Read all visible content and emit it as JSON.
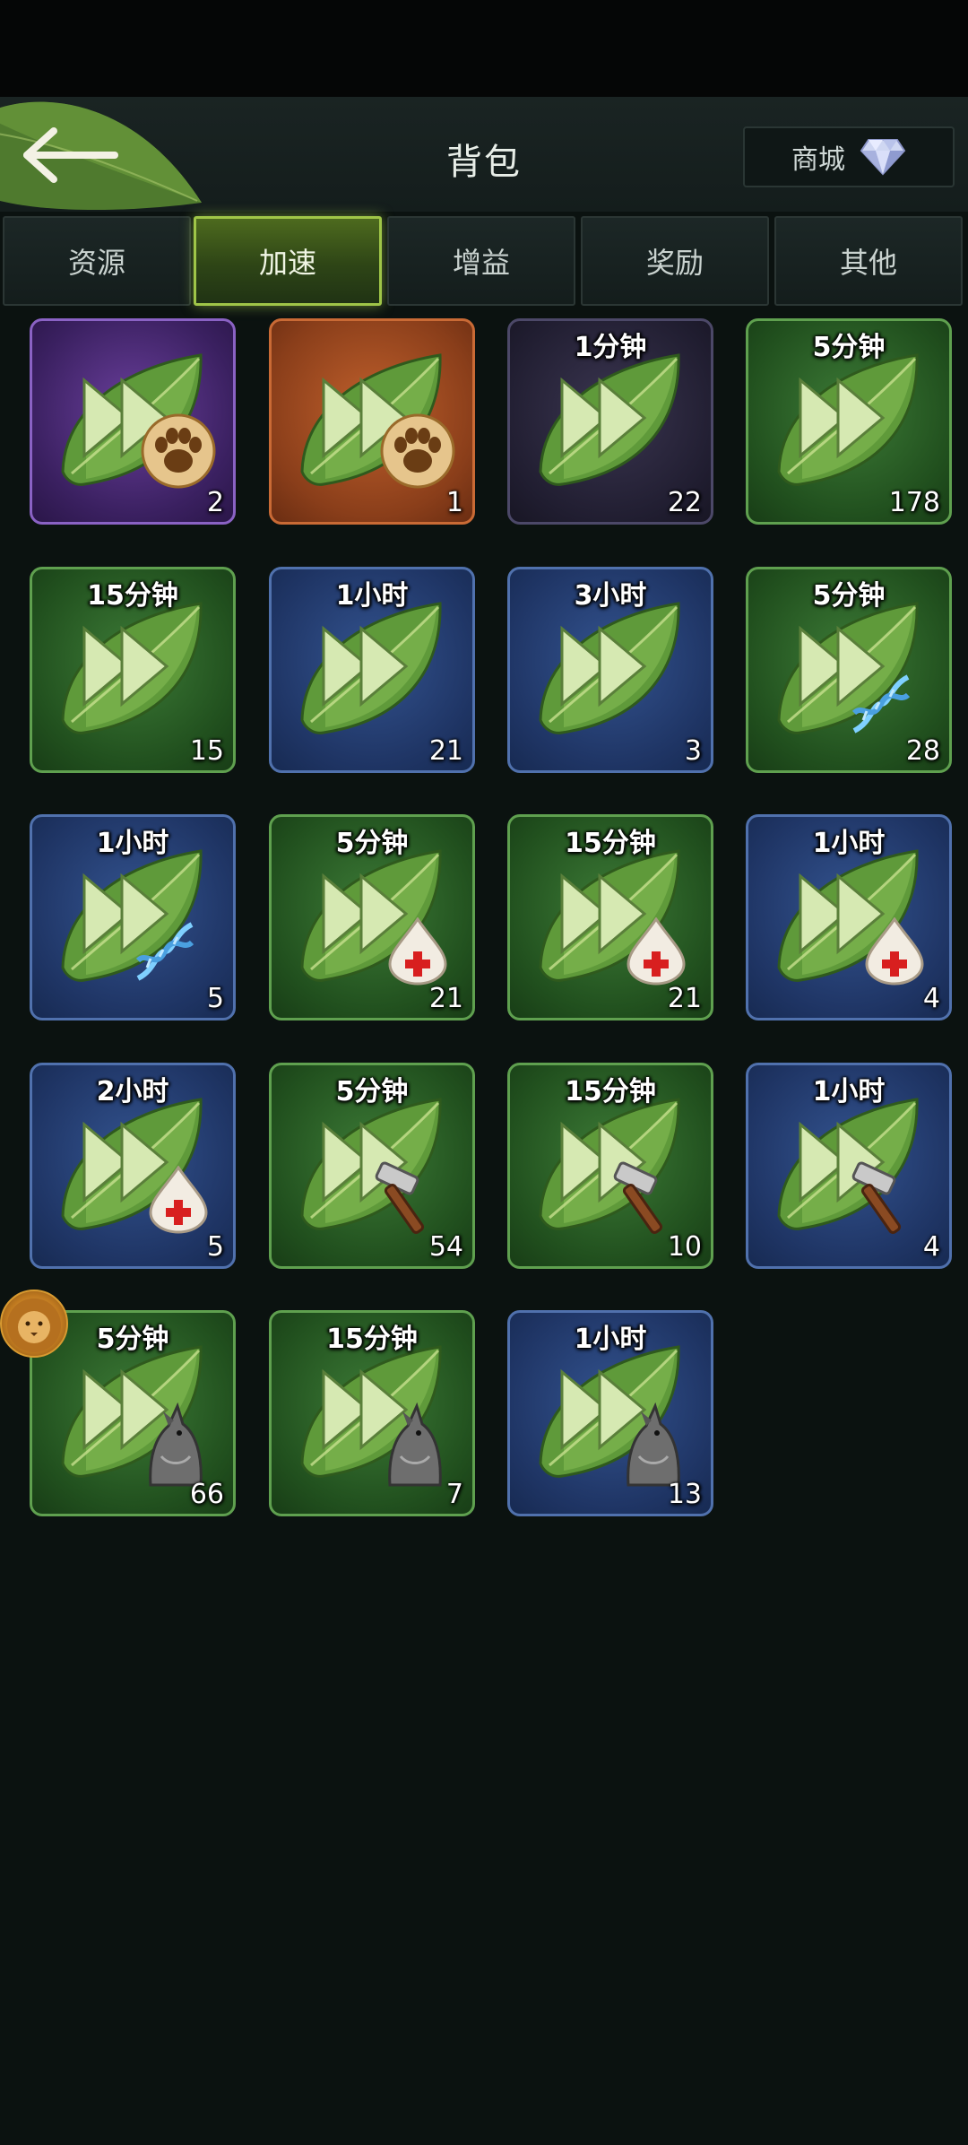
{
  "header": {
    "title": "背包",
    "shop_label": "商城"
  },
  "tabs": [
    {
      "label": "资源",
      "active": false
    },
    {
      "label": "加速",
      "active": true
    },
    {
      "label": "增益",
      "active": false
    },
    {
      "label": "奖励",
      "active": false
    },
    {
      "label": "其他",
      "active": false
    }
  ],
  "items": [
    {
      "label": "",
      "count": "2",
      "bg": "purple",
      "icon": "paw-icon"
    },
    {
      "label": "",
      "count": "1",
      "bg": "orange",
      "icon": "paw-icon"
    },
    {
      "label": "1分钟",
      "count": "22",
      "bg": "dark",
      "icon": "none"
    },
    {
      "label": "5分钟",
      "count": "178",
      "bg": "green",
      "icon": "none"
    },
    {
      "label": "15分钟",
      "count": "15",
      "bg": "green",
      "icon": "none"
    },
    {
      "label": "1小时",
      "count": "21",
      "bg": "blue",
      "icon": "none"
    },
    {
      "label": "3小时",
      "count": "3",
      "bg": "blue",
      "icon": "none"
    },
    {
      "label": "5分钟",
      "count": "28",
      "bg": "green",
      "icon": "dna-icon"
    },
    {
      "label": "1小时",
      "count": "5",
      "bg": "blue",
      "icon": "dna-icon"
    },
    {
      "label": "5分钟",
      "count": "21",
      "bg": "green",
      "icon": "blood-drop-icon"
    },
    {
      "label": "15分钟",
      "count": "21",
      "bg": "green",
      "icon": "blood-drop-icon"
    },
    {
      "label": "1小时",
      "count": "4",
      "bg": "blue",
      "icon": "blood-drop-icon"
    },
    {
      "label": "2小时",
      "count": "5",
      "bg": "blue",
      "icon": "blood-drop-icon"
    },
    {
      "label": "5分钟",
      "count": "54",
      "bg": "green",
      "icon": "hammer-icon"
    },
    {
      "label": "15分钟",
      "count": "10",
      "bg": "green",
      "icon": "hammer-icon"
    },
    {
      "label": "1小时",
      "count": "4",
      "bg": "blue",
      "icon": "hammer-icon"
    },
    {
      "label": "5分钟",
      "count": "66",
      "bg": "green",
      "icon": "wolf-icon"
    },
    {
      "label": "15分钟",
      "count": "7",
      "bg": "green",
      "icon": "wolf-icon"
    },
    {
      "label": "1小时",
      "count": "13",
      "bg": "blue",
      "icon": "wolf-icon"
    }
  ]
}
